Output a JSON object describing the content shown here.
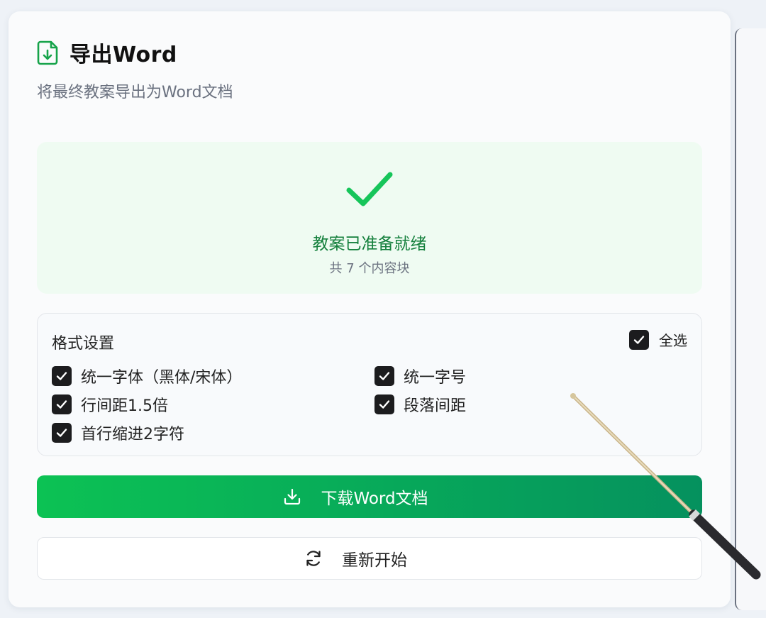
{
  "colors": {
    "accent": "#16a34a",
    "ready_bg": "#effbf2",
    "button_start": "#0cc254",
    "button_end": "#05915e",
    "checkbox": "#1c1c1e"
  },
  "header": {
    "icon": "file-download-icon",
    "title": "导出Word",
    "subtitle": "将最终教案导出为Word文档"
  },
  "ready": {
    "icon": "check-icon",
    "title": "教案已准备就绪",
    "count": "共 7 个内容块"
  },
  "format": {
    "title": "格式设置",
    "select_all": {
      "label": "全选",
      "checked": true
    },
    "options": [
      {
        "label": "统一字体（黑体/宋体）",
        "checked": true
      },
      {
        "label": "统一字号",
        "checked": true
      },
      {
        "label": "行间距1.5倍",
        "checked": true
      },
      {
        "label": "段落间距",
        "checked": true
      },
      {
        "label": "首行缩进2字符",
        "checked": true
      }
    ]
  },
  "actions": {
    "download": {
      "label": "下载Word文档",
      "icon": "download-icon"
    },
    "restart": {
      "label": "重新开始",
      "icon": "refresh-icon"
    }
  }
}
